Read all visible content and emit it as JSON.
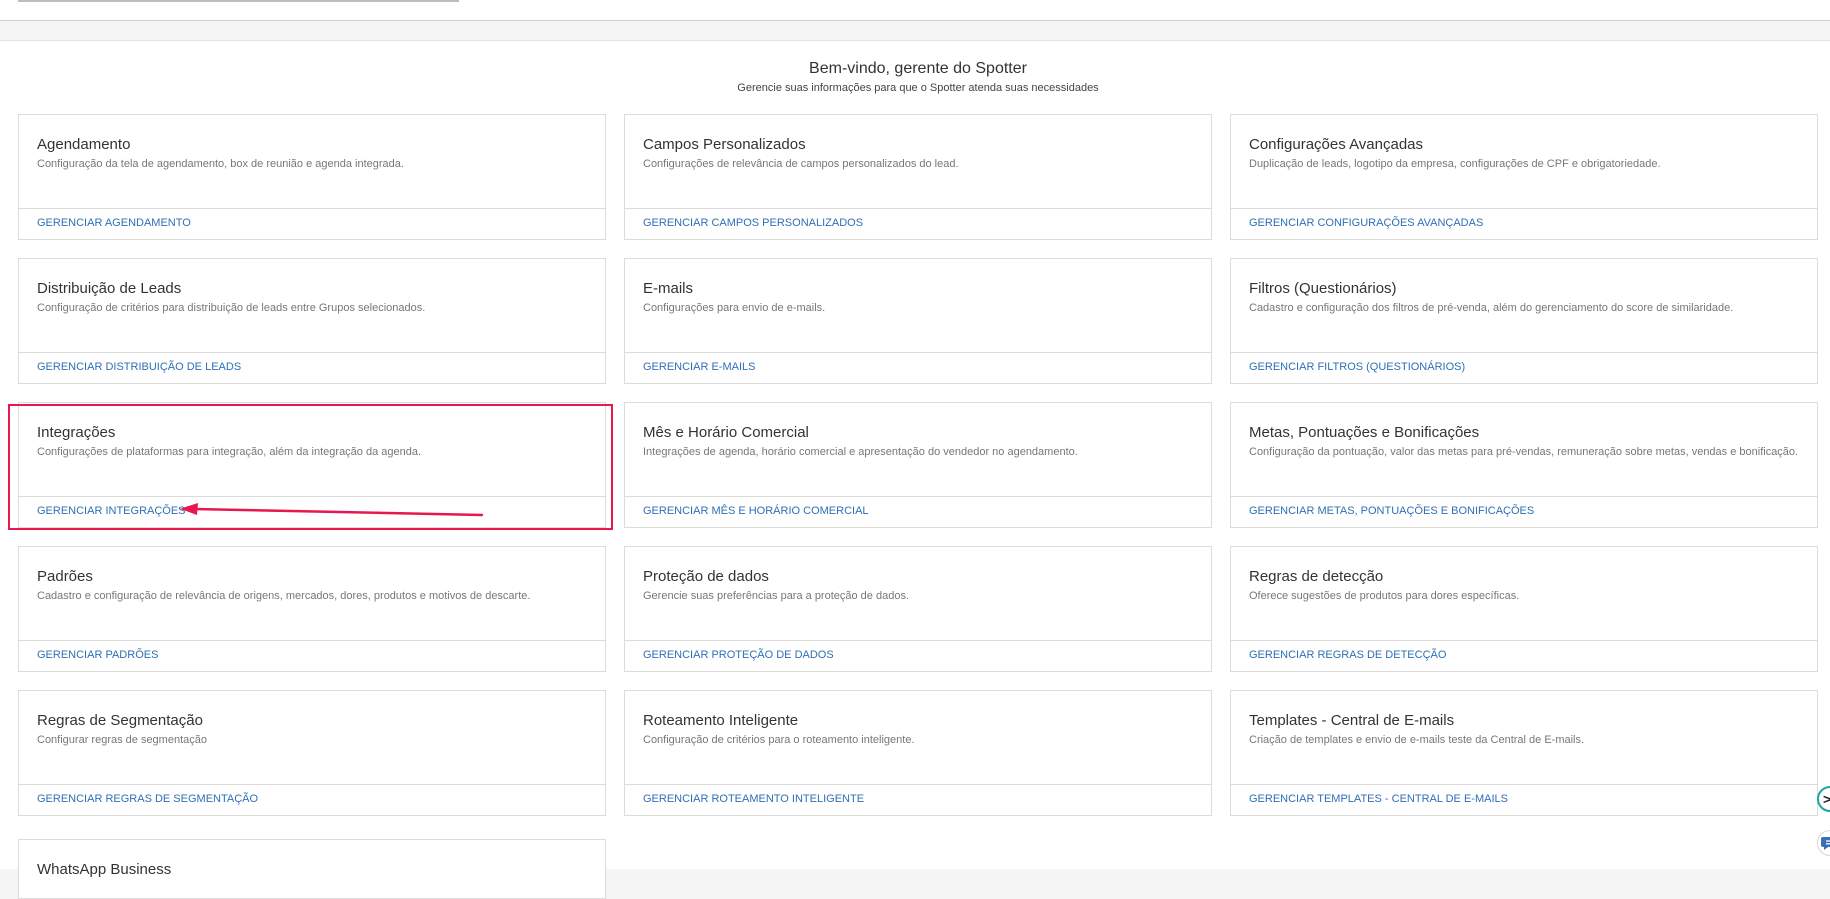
{
  "header": {
    "title": "Bem-vindo, gerente do Spotter",
    "subtitle": "Gerencie suas informações para que o Spotter atenda suas necessidades"
  },
  "cards": [
    {
      "title": "Agendamento",
      "description": "Configuração da tela de agendamento, box de reunião e agenda integrada.",
      "action": "GERENCIAR AGENDAMENTO"
    },
    {
      "title": "Campos Personalizados",
      "description": "Configurações de relevância de campos personalizados do lead.",
      "action": "GERENCIAR CAMPOS PERSONALIZADOS"
    },
    {
      "title": "Configurações Avançadas",
      "description": "Duplicação de leads, logotipo da empresa, configurações de CPF e obrigatoriedade.",
      "action": "GERENCIAR CONFIGURAÇÕES AVANÇADAS"
    },
    {
      "title": "Distribuição de Leads",
      "description": "Configuração de critérios para distribuição de leads entre Grupos selecionados.",
      "action": "GERENCIAR DISTRIBUIÇÃO DE LEADS"
    },
    {
      "title": "E-mails",
      "description": "Configurações para envio de e-mails.",
      "action": "GERENCIAR E-MAILS"
    },
    {
      "title": "Filtros (Questionários)",
      "description": "Cadastro e configuração dos filtros de pré-venda, além do gerenciamento do score de similaridade.",
      "action": "GERENCIAR FILTROS (QUESTIONÁRIOS)"
    },
    {
      "title": "Integrações",
      "description": "Configurações de plataformas para integração, além da integração da agenda.",
      "action": "GERENCIAR INTEGRAÇÕES"
    },
    {
      "title": "Mês e Horário Comercial",
      "description": "Integrações de agenda, horário comercial e apresentação do vendedor no agendamento.",
      "action": "GERENCIAR MÊS E HORÁRIO COMERCIAL"
    },
    {
      "title": "Metas, Pontuações e Bonificações",
      "description": "Configuração da pontuação, valor das metas para pré-vendas, remuneração sobre metas, vendas e bonificação.",
      "action": "GERENCIAR METAS, PONTUAÇÕES E BONIFICAÇÕES"
    },
    {
      "title": "Padrões",
      "description": "Cadastro e configuração de relevância de origens, mercados, dores, produtos e motivos de descarte.",
      "action": "GERENCIAR PADRÕES"
    },
    {
      "title": "Proteção de dados",
      "description": "Gerencie suas preferências para a proteção de dados.",
      "action": "GERENCIAR PROTEÇÃO DE DADOS"
    },
    {
      "title": "Regras de detecção",
      "description": "Oferece sugestões de produtos para dores específicas.",
      "action": "GERENCIAR REGRAS DE DETECÇÃO"
    },
    {
      "title": "Regras de Segmentação",
      "description": "Configurar regras de segmentação",
      "action": "GERENCIAR REGRAS DE SEGMENTAÇÃO"
    },
    {
      "title": "Roteamento Inteligente",
      "description": "Configuração de critérios para o roteamento inteligente.",
      "action": "GERENCIAR ROTEAMENTO INTELIGENTE"
    },
    {
      "title": "Templates - Central de E-mails",
      "description": "Criação de templates e envio de e-mails teste da Central de E-mails.",
      "action": "GERENCIAR TEMPLATES - CENTRAL DE E-MAILS"
    }
  ],
  "partial_card": {
    "title": "WhatsApp Business"
  },
  "side_buttons": {
    "expand_glyph": ">",
    "chat_icon": "chat-icon"
  },
  "colors": {
    "highlight": "#e8174f",
    "link": "#2f6fb5",
    "accent": "#1aa6a6"
  }
}
